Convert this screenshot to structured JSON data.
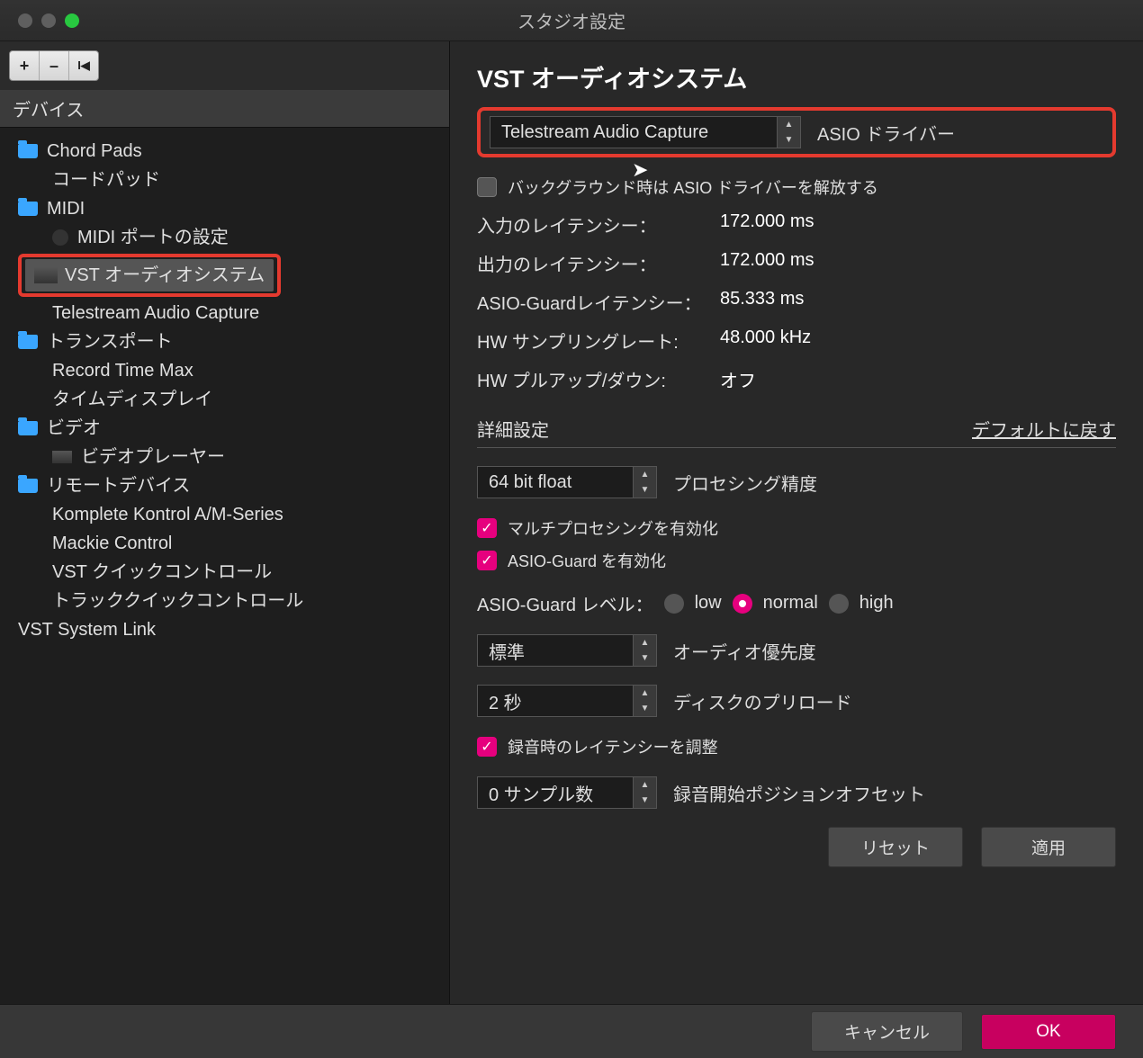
{
  "window": {
    "title": "スタジオ設定"
  },
  "toolbar": {
    "plus": "+",
    "minus": "–",
    "first": "I◂"
  },
  "left": {
    "devices_label": "デバイス",
    "tree": {
      "chord_pads": "Chord Pads",
      "chord_pad_jp": "コードパッド",
      "midi": "MIDI",
      "midi_port": "MIDI ポートの設定",
      "vst_audio": "VST オーディオシステム",
      "telestream": "Telestream Audio Capture",
      "transport": "トランスポート",
      "record_time_max": "Record Time Max",
      "time_display": "タイムディスプレイ",
      "video": "ビデオ",
      "video_player": "ビデオプレーヤー",
      "remote": "リモートデバイス",
      "komplete": "Komplete Kontrol A/M-Series",
      "mackie": "Mackie Control",
      "vst_quick": "VST クイックコントロール",
      "track_quick": "トラッククイックコントロール",
      "vst_link": "VST System Link"
    }
  },
  "right": {
    "heading": "VST オーディオシステム",
    "driver": {
      "value": "Telestream Audio Capture",
      "label": "ASIO ドライバー"
    },
    "release_bg": "バックグラウンド時は ASIO ドライバーを解放する",
    "latency_in_label": "入力のレイテンシー：",
    "latency_in_val": "172.000 ms",
    "latency_out_label": "出力のレイテンシー：",
    "latency_out_val": "172.000 ms",
    "asio_guard_lat_label": "ASIO-Guardレイテンシー：",
    "asio_guard_lat_val": "85.333 ms",
    "hw_rate_label": "HW サンプリングレート:",
    "hw_rate_val": "48.000 kHz",
    "hw_pull_label": "HW プルアップ/ダウン:",
    "hw_pull_val": "オフ",
    "advanced": "詳細設定",
    "reset_defaults": "デフォルトに戻す",
    "processing_precision": {
      "value": "64 bit float",
      "label": "プロセシング精度"
    },
    "multi_proc": "マルチプロセシングを有効化",
    "asio_guard_enable": "ASIO-Guard を有効化",
    "asio_guard_level_label": "ASIO-Guard レベル：",
    "asio_guard_levels": {
      "low": "low",
      "normal": "normal",
      "high": "high"
    },
    "audio_priority": {
      "value": "標準",
      "label": "オーディオ優先度"
    },
    "disk_preload": {
      "value": "2 秒",
      "label": "ディスクのプリロード"
    },
    "rec_lat_adjust": "録音時のレイテンシーを調整",
    "rec_offset": {
      "value": "0 サンプル数",
      "label": "録音開始ポジションオフセット"
    },
    "reset_btn": "リセット",
    "apply_btn": "適用"
  },
  "footer": {
    "cancel": "キャンセル",
    "ok": "OK"
  }
}
